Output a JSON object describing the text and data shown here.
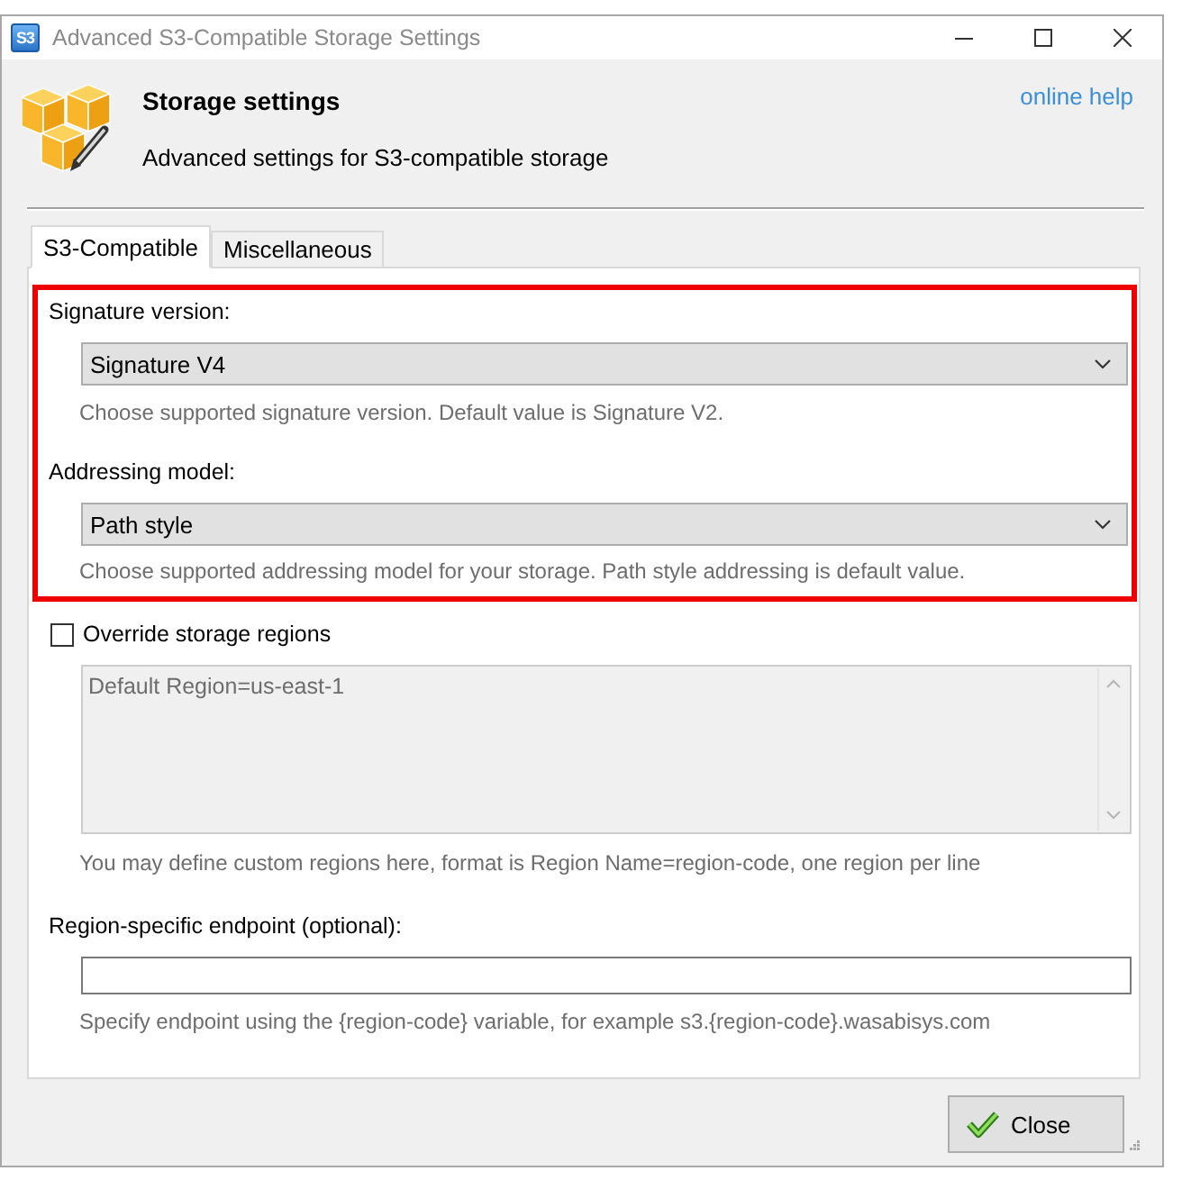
{
  "window": {
    "icon_text": "S3",
    "title": "Advanced S3-Compatible Storage Settings"
  },
  "header": {
    "title": "Storage settings",
    "subtitle": "Advanced settings for S3-compatible storage",
    "help_link": "online help"
  },
  "tabs": [
    {
      "label": "S3-Compatible",
      "selected": true
    },
    {
      "label": "Miscellaneous",
      "selected": false
    }
  ],
  "highlighted_section": {
    "highlighted": true,
    "fields": [
      {
        "label": "Signature version:",
        "value": "Signature V4",
        "hint": "Choose supported signature version. Default value is Signature V2."
      },
      {
        "label": "Addressing model:",
        "value": "Path style",
        "hint": "Choose supported addressing model for your storage. Path style addressing is default value."
      }
    ]
  },
  "override_regions": {
    "label": "Override storage regions",
    "checked": false
  },
  "regions_box": {
    "value": "Default Region=us-east-1",
    "disabled": true,
    "hint": "You may define custom regions here, format is Region Name=region-code, one region per line"
  },
  "endpoint": {
    "label": "Region-specific endpoint (optional):",
    "hint": "Specify endpoint using the {region-code} variable, for example s3.{region-code}.wasabisys.com"
  },
  "buttons": [
    {
      "label": "Close"
    }
  ]
}
